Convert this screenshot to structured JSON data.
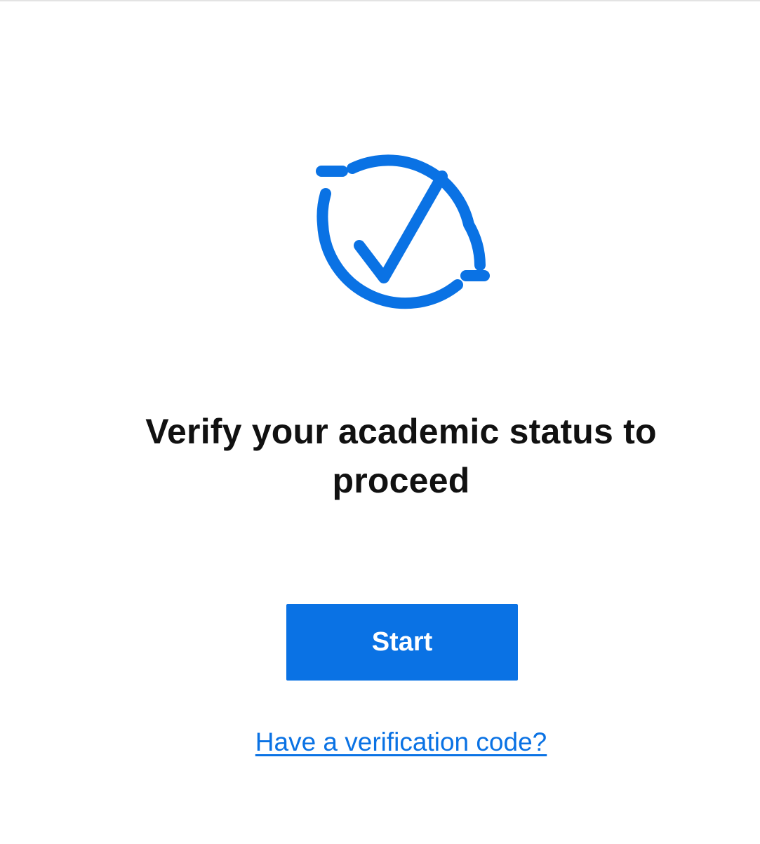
{
  "brand_color": "#0a72e4",
  "icon": {
    "name": "verify-check-cycle-icon"
  },
  "heading": {
    "text": "Verify your academic status to proceed"
  },
  "start_button": {
    "label": "Start"
  },
  "verification_link": {
    "text": "Have a verification code?"
  }
}
